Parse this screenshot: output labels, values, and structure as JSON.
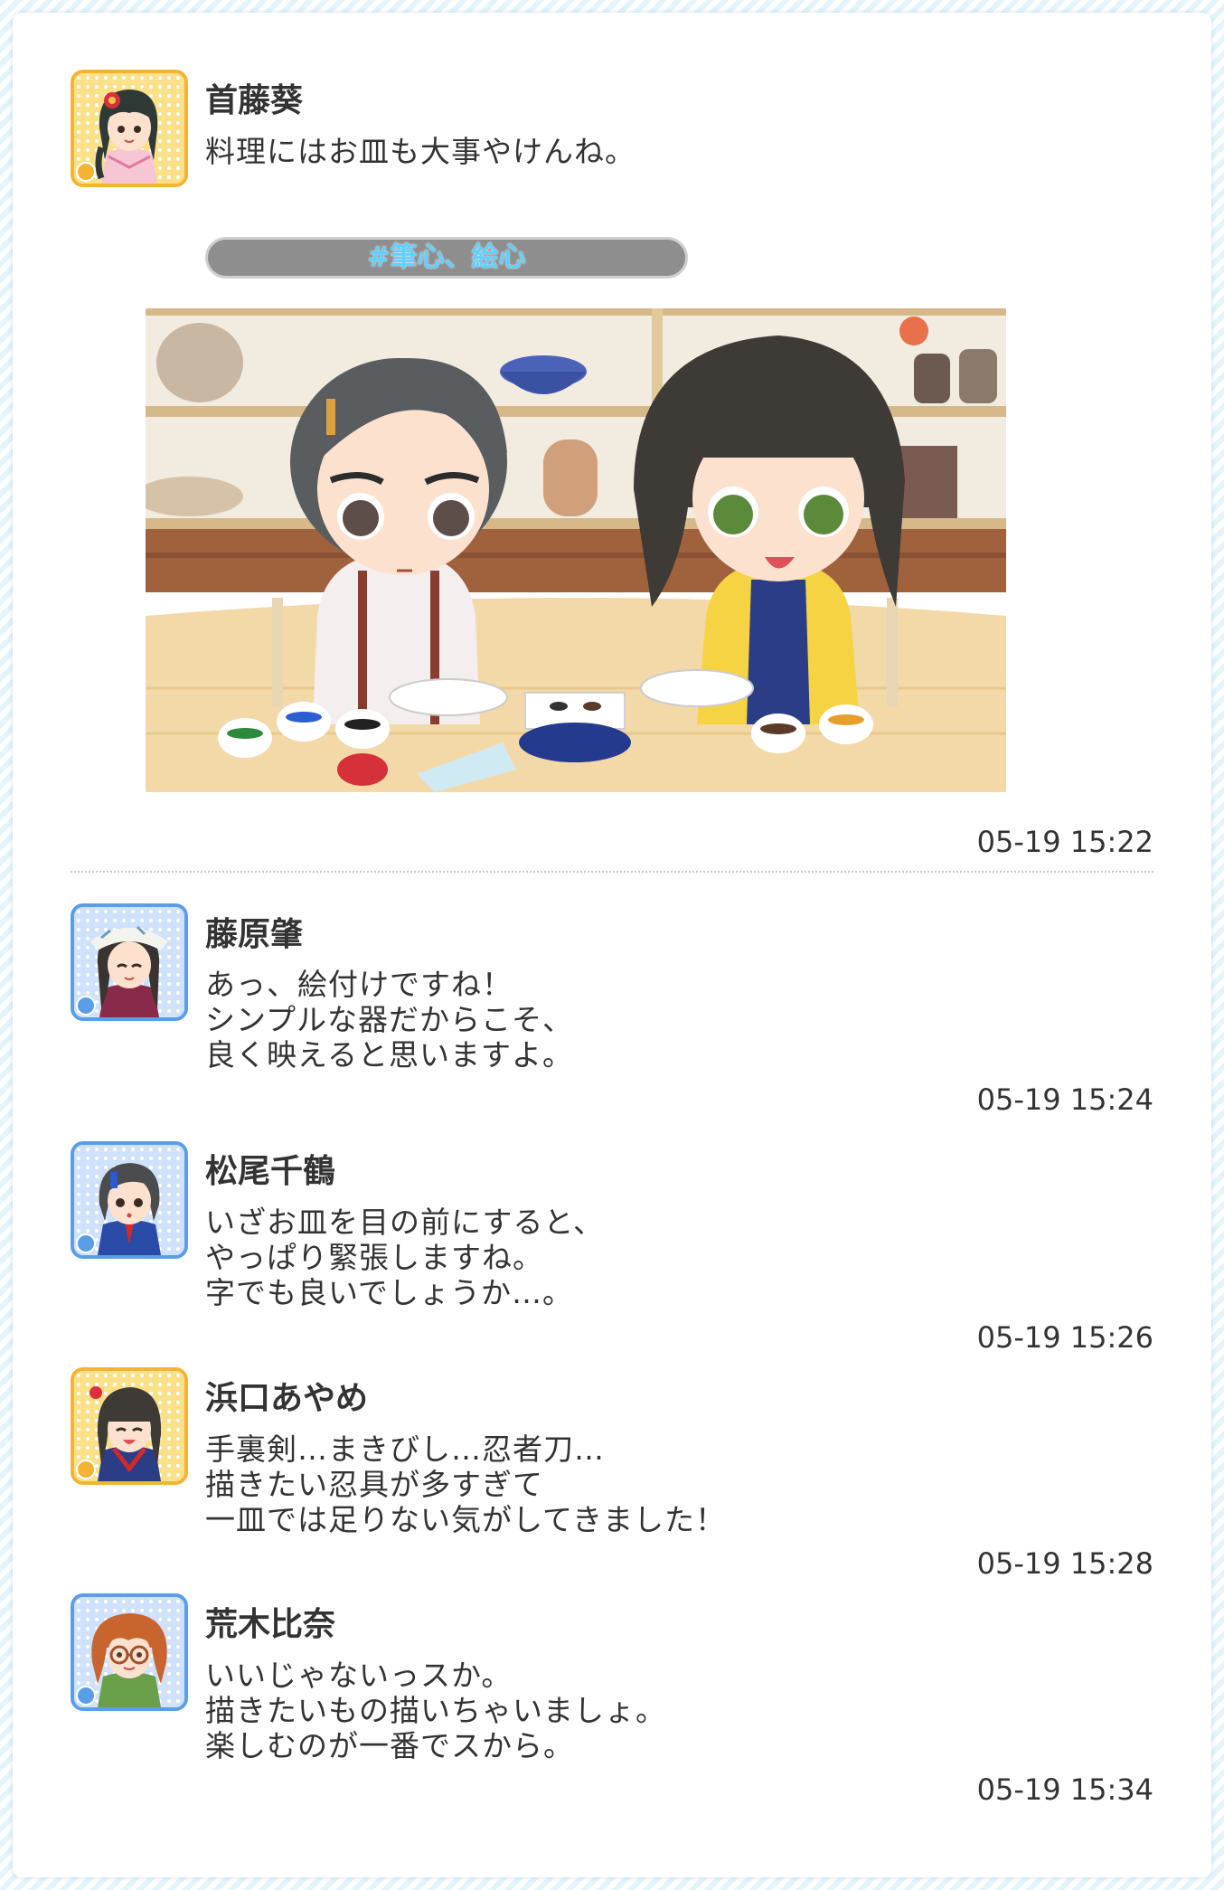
{
  "posts": [
    {
      "author": "首藤葵",
      "lines": [
        "料理にはお皿も大事やけんね。"
      ],
      "hashtag": "#筆心、絵心",
      "time": "05-19 15:22",
      "avatar_frame": "gold",
      "avatar_badge": "flower-badge-icon"
    },
    {
      "author": "藤原肇",
      "lines": [
        "あっ、絵付けですね！",
        "シンプルな器だからこそ、",
        "良く映えると思いますよ。"
      ],
      "time": "05-19 15:24",
      "avatar_frame": "blue",
      "avatar_badge": "diamond-badge-icon"
    },
    {
      "author": "松尾千鶴",
      "lines": [
        "いざお皿を目の前にすると、",
        "やっぱり緊張しますね。",
        "字でも良いでしょうか…。"
      ],
      "time": "05-19 15:26",
      "avatar_frame": "blue",
      "avatar_badge": "diamond-badge-icon"
    },
    {
      "author": "浜口あやめ",
      "lines": [
        "手裏剣…まきびし…忍者刀…",
        "描きたい忍具が多すぎて",
        "一皿では足りない気がしてきました！"
      ],
      "time": "05-19 15:28",
      "avatar_frame": "gold",
      "avatar_badge": "flower-badge-icon"
    },
    {
      "author": "荒木比奈",
      "lines": [
        "いいじゃないっスか。",
        "描きたいもの描いちゃいましょ。",
        "楽しむのが一番でスから。"
      ],
      "time": "05-19 15:34",
      "avatar_frame": "blue",
      "avatar_badge": "diamond-badge-icon"
    }
  ],
  "colors": {
    "gold_frame": "#f5b335",
    "blue_frame": "#5a9ee8",
    "hashtag_text": "#5fd0ff",
    "hashtag_bg": "#8e8e8e",
    "text": "#333333"
  }
}
